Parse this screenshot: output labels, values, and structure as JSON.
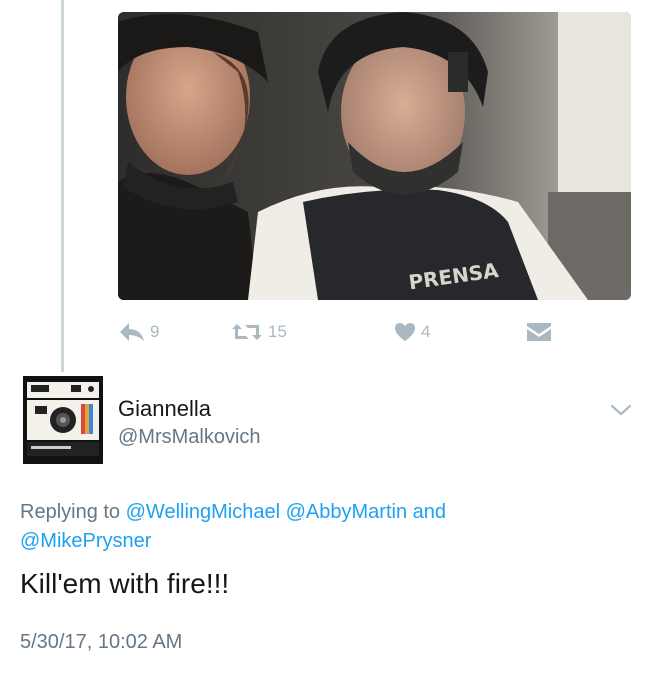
{
  "previous_tweet": {
    "media_description": "selfie in vehicle",
    "media_text": "PRENSA",
    "actions": {
      "reply_count": "9",
      "retweet_count": "15",
      "like_count": "4"
    }
  },
  "reply": {
    "author": {
      "display_name": "Giannella",
      "handle": "@MrsMalkovich"
    },
    "replying_prefix": "Replying to",
    "mentions": [
      "@WellingMichael",
      "@AbbyMartin"
    ],
    "mention_joiner": "and",
    "mention_last": "@MikePrysner",
    "text": "Kill'em with fire!!!",
    "timestamp": "5/30/17, 10:02 AM"
  },
  "colors": {
    "link": "#1da1f2",
    "secondary_text": "#657786",
    "icon_gray": "#aab8c2",
    "thread_line": "#cdd5dc"
  },
  "icons": {
    "reply": "reply-icon",
    "retweet": "retweet-icon",
    "like": "heart-icon",
    "message": "direct-message-icon",
    "more": "chevron-down-icon"
  }
}
